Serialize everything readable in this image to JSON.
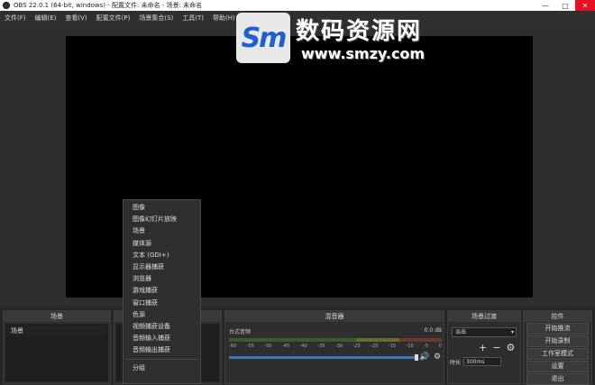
{
  "window": {
    "title": "OBS 22.0.1 (64-bit, windows) - 配置文件: 未命名 - 场景: 未命名",
    "minimize": "—",
    "maximize": "□",
    "close": "✕"
  },
  "menu": [
    "文件(F)",
    "编辑(E)",
    "查看(V)",
    "配置文件(P)",
    "场景集合(S)",
    "工具(T)",
    "帮助(H)"
  ],
  "watermark": {
    "logo": "Sm",
    "name": "数码资源网",
    "url": "www.smzy.com"
  },
  "context_menu": {
    "items": [
      "图像",
      "图像幻灯片放映",
      "场景",
      "媒体源",
      "文本 (GDI+)",
      "显示器捕获",
      "浏览器",
      "游戏捕获",
      "窗口捕获",
      "色源",
      "视频捕获设备",
      "音频输入捕获",
      "音频输出捕获"
    ],
    "after_separator": [
      "分组"
    ]
  },
  "docks": {
    "scenes": {
      "title": "场景",
      "items": [
        "场景"
      ]
    },
    "sources": {
      "title": "来源"
    },
    "mixer": {
      "title": "混音器",
      "channel_name": "台式音频",
      "channel_db": "0.0 dB",
      "ticks": [
        "-60",
        "-55",
        "-50",
        "-45",
        "-40",
        "-35",
        "-30",
        "-25",
        "-20",
        "-15",
        "-10",
        "-5",
        "0"
      ]
    },
    "transitions": {
      "title": "场景过渡",
      "selected": "淡出",
      "add": "+",
      "remove": "−",
      "settings": "⚙",
      "duration_label": "时长",
      "duration_value": "300ms"
    },
    "controls": {
      "title": "控件",
      "buttons": [
        "开始推流",
        "开始录制",
        "工作室模式",
        "设置",
        "退出"
      ]
    }
  },
  "colors": {
    "accent": "#3c78b4",
    "close": "#e81123",
    "panel": "#2e2e2e"
  }
}
